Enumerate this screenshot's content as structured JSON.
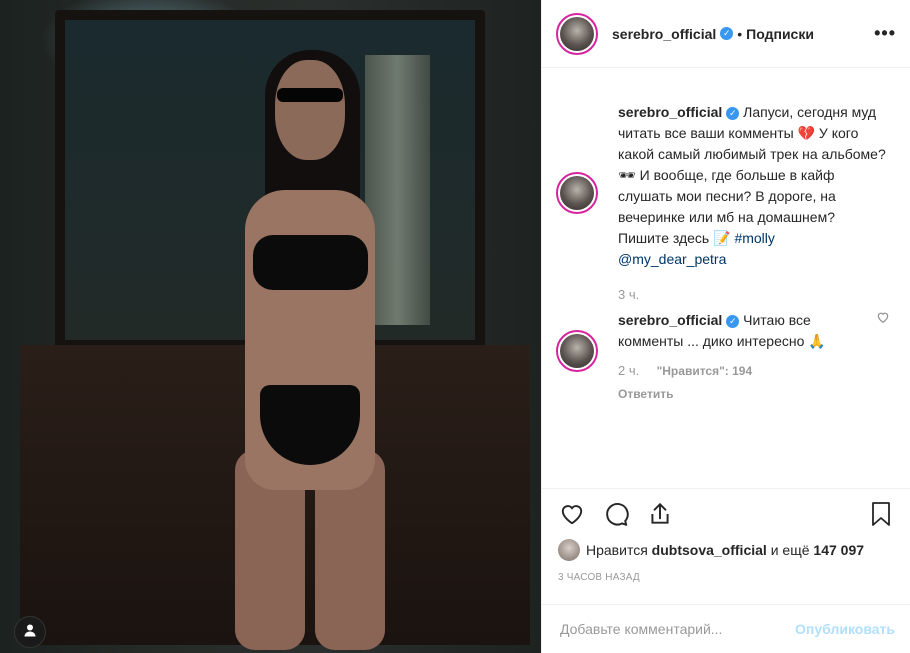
{
  "photo": {
    "user_tag_icon": "user-icon"
  },
  "post": {
    "username": "serebro_official",
    "verified_icon": "verified-badge-icon",
    "dot": "•",
    "follow_label": "Подписки",
    "more_icon": "•••"
  },
  "caption": {
    "username": "serebro_official",
    "text_1": " Лапуси, сегодня муд читать все ваши комменты 💔 У кого какой самый любимый трек на альбоме? 🕶 И вообще, где больше в кайф слушать мои песни? В дороге, на вечеринке или мб на домашнем? Пишите здесь 📝 ",
    "hashtag": "#molly",
    "mention": "@my_dear_petra",
    "time": "3 ч."
  },
  "comment": {
    "username": "serebro_official",
    "text": " Читаю все комменты ... дико интересно 🙏",
    "time": "2 ч.",
    "likes": "\"Нравится\": 194",
    "reply_label": "Ответить",
    "like_icon": "heart-outline-icon"
  },
  "actions": {
    "like_icon": "heart-icon",
    "comment_icon": "comment-icon",
    "share_icon": "share-icon",
    "save_icon": "bookmark-icon"
  },
  "likes": {
    "prefix": "Нравится ",
    "user": "dubtsova_official",
    "middle": " и ещё ",
    "count": "147 097"
  },
  "timestamp": "3 часов назад",
  "add_comment": {
    "placeholder": "Добавьте комментарий...",
    "publish_label": "Опубликовать"
  },
  "colors": {
    "accent": "#3897f0",
    "publish_disabled": "#b2dffc",
    "link": "#003569"
  }
}
